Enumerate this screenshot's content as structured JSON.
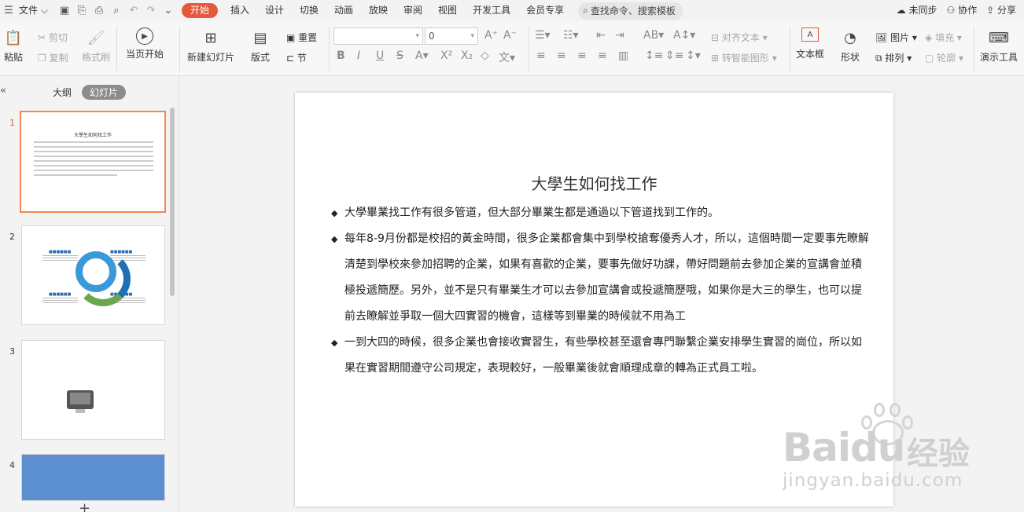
{
  "menubar": {
    "file": "文件",
    "tabs": [
      "开始",
      "插入",
      "设计",
      "切换",
      "动画",
      "放映",
      "审阅",
      "视图",
      "开发工具",
      "会员专享"
    ],
    "search_placeholder": "查找命令、搜索模板",
    "right": {
      "unsync": "未同步",
      "collab": "协作",
      "share": "分享"
    }
  },
  "ribbon": {
    "paste": "粘贴",
    "cut": "剪切",
    "copy": "复制",
    "format_painter": "格式刷",
    "start_current": "当页开始",
    "new_slide": "新建幻灯片",
    "layout": "版式",
    "reset": "重置",
    "section": "节",
    "font_size": "0",
    "align_text": "对齐文本",
    "smartart": "转智能图形",
    "textbox": "文本框",
    "shape": "形状",
    "picture": "图片",
    "fill": "填充",
    "arrange": "排列",
    "outline": "轮廓",
    "present_tools": "演示工具"
  },
  "leftpanel": {
    "tab_outline": "大纲",
    "tab_slides": "幻灯片",
    "slide_numbers": [
      "1",
      "2",
      "3",
      "4"
    ]
  },
  "slide": {
    "title": "大學生如何找工作",
    "bullets": [
      "大學畢業找工作有很多管道，但大部分畢業生都是通過以下管道找到工作的。",
      "每年8-9月份都是校招的黃金時間，很多企業都會集中到學校搶奪優秀人才，所以，這個時間一定要事先瞭解清楚到學校來參加招聘的企業，如果有喜歡的企業，要事先做好功課，帶好問題前去參加企業的宣講會並積極投遞簡歷。另外，並不是只有畢業生才可以去參加宣講會或投遞簡歷哦，如果你是大三的學生，也可以提前去瞭解並爭取一個大四實習的機會，這樣等到畢業的時候就不用為工",
      "一到大四的時候，很多企業也會接收實習生，有些學校甚至還會專門聯繫企業安排學生實習的崗位，所以如果在實習期間遵守公司規定，表現較好，一般畢業後就會順理成章的轉為正式員工啦。"
    ]
  },
  "watermark": {
    "logo": "Bai",
    "logo2": "du",
    "cn": "经验",
    "url": "jingyan.baidu.com"
  }
}
